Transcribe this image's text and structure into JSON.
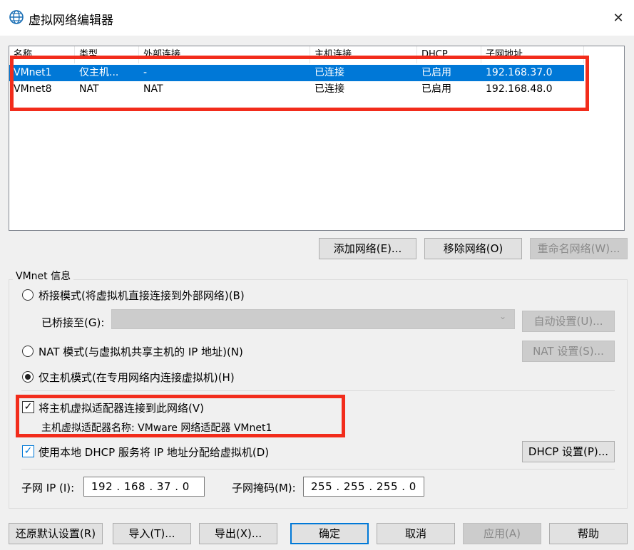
{
  "window": {
    "title": "虚拟网络编辑器",
    "close_glyph": "✕"
  },
  "network_list": {
    "columns": [
      "名称",
      "类型",
      "外部连接",
      "主机连接",
      "DHCP",
      "子网地址"
    ],
    "rows": [
      {
        "name": "VMnet1",
        "type": "仅主机...",
        "external": "-",
        "host": "已连接",
        "dhcp": "已启用",
        "subnet": "192.168.37.0",
        "selected": true
      },
      {
        "name": "VMnet8",
        "type": "NAT",
        "external": "NAT",
        "host": "已连接",
        "dhcp": "已启用",
        "subnet": "192.168.48.0",
        "selected": false
      }
    ]
  },
  "list_buttons": {
    "add": "添加网络(E)...",
    "remove": "移除网络(O)",
    "rename": "重命名网络(W)..."
  },
  "vmnet_info": {
    "group_title": "VMnet 信息",
    "bridged_label": "桥接模式(将虚拟机直接连接到外部网络)(B)",
    "bridged_to_label": "已桥接至(G):",
    "bridged_to_value": "",
    "auto_settings": "自动设置(U)...",
    "nat_label": "NAT 模式(与虚拟机共享主机的 IP 地址)(N)",
    "nat_settings": "NAT 设置(S)...",
    "hostonly_label": "仅主机模式(在专用网络内连接虚拟机)(H)",
    "selected_mode": "hostonly",
    "connect_adapter_label": "将主机虚拟适配器连接到此网络(V)",
    "connect_adapter_checked": true,
    "adapter_name_text": "主机虚拟适配器名称: VMware 网络适配器 VMnet1",
    "dhcp_label": "使用本地 DHCP 服务将 IP 地址分配给虚拟机(D)",
    "dhcp_checked": true,
    "dhcp_settings": "DHCP 设置(P)...",
    "subnet_ip_label": "子网 IP (I):",
    "subnet_ip": "192 . 168 .  37  .  0",
    "subnet_mask_label": "子网掩码(M):",
    "subnet_mask": "255 . 255 . 255 .  0"
  },
  "footer_buttons": {
    "restore": "还原默认设置(R)",
    "import": "导入(T)...",
    "export": "导出(X)...",
    "ok": "确定",
    "cancel": "取消",
    "apply": "应用(A)",
    "help": "帮助"
  },
  "colors": {
    "selection": "#0078d7",
    "highlight_box": "#f22c1b"
  },
  "check_glyph": "✓"
}
